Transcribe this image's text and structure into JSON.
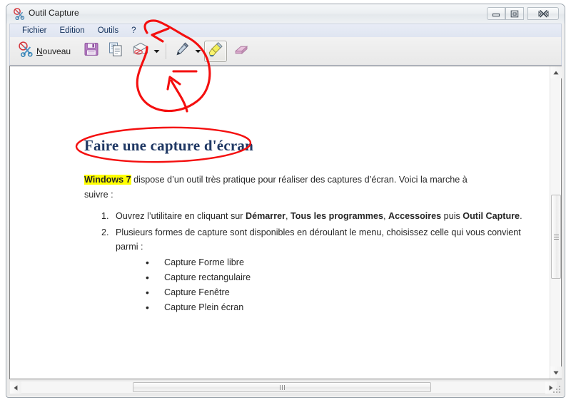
{
  "window": {
    "title": "Outil Capture",
    "icon": "scissors-icon",
    "controls": {
      "minimize": "minimize-icon",
      "restore": "restore-icon",
      "close": "close-icon"
    }
  },
  "menu": {
    "items": [
      {
        "label": "Fichier"
      },
      {
        "label": "Edition"
      },
      {
        "label": "Outils"
      },
      {
        "label": "?"
      }
    ]
  },
  "toolbar": {
    "new_label": "Nouveau",
    "new_accel": "N",
    "buttons": [
      {
        "name": "new-capture-button",
        "icon": "scissors-icon",
        "label": "Nouveau"
      },
      {
        "name": "save-button",
        "icon": "floppy-disk-icon",
        "label": ""
      },
      {
        "name": "copy-button",
        "icon": "copy-icon",
        "label": ""
      },
      {
        "name": "email-button",
        "icon": "envelope-icon",
        "label": ""
      },
      {
        "name": "pen-button",
        "icon": "pen-icon",
        "label": ""
      },
      {
        "name": "highlighter-button",
        "icon": "highlighter-icon",
        "label": ""
      },
      {
        "name": "eraser-button",
        "icon": "eraser-icon",
        "label": ""
      }
    ],
    "active_tool": "highlighter-button"
  },
  "document": {
    "heading": "Faire une capture d'écran",
    "intro": {
      "highlight": "Windows 7",
      "rest": " dispose d’un outil très pratique pour réaliser des captures d’écran. Voici la marche à suivre :"
    },
    "steps": [
      {
        "parts": [
          {
            "text": "Ouvrez l’utilitaire en cliquant sur ",
            "bold": false
          },
          {
            "text": "Démarrer",
            "bold": true
          },
          {
            "text": ", ",
            "bold": false
          },
          {
            "text": "Tous les programmes",
            "bold": true
          },
          {
            "text": ", ",
            "bold": false
          },
          {
            "text": "Accessoires",
            "bold": true
          },
          {
            "text": " puis ",
            "bold": false
          },
          {
            "text": "Outil Capture",
            "bold": true
          },
          {
            "text": ".",
            "bold": false
          }
        ]
      },
      {
        "parts": [
          {
            "text": "Plusieurs formes de capture sont disponibles en déroulant le menu, choisissez celle qui vous convient parmi :",
            "bold": false
          }
        ]
      }
    ],
    "capture_modes": [
      "Capture Forme libre",
      "Capture rectangulaire",
      "Capture Fenêtre",
      "Capture Plein écran"
    ]
  },
  "annotations": {
    "ink_color": "#f40f0f",
    "highlight_color": "#ffff00",
    "heading_color": "#1f3864",
    "description": "red-ink-circle-around-pen-tools"
  },
  "scrollbars": {
    "vertical": {
      "up": "triangle-up-icon",
      "down": "triangle-down-icon",
      "thumb": "scroll-thumb"
    },
    "horizontal": {
      "left": "triangle-left-icon",
      "right": "triangle-right-icon",
      "thumb": "scroll-thumb"
    }
  }
}
